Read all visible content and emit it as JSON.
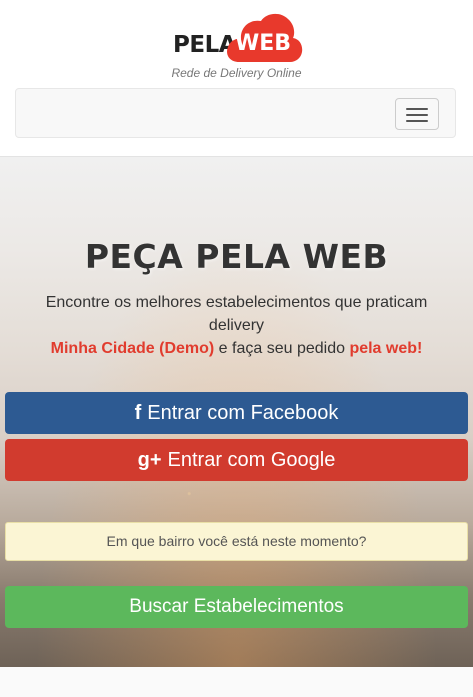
{
  "brand": {
    "logo_left": "PELA",
    "logo_right": "WEB",
    "tagline": "Rede de Delivery Online",
    "cloud_color": "#e8392c"
  },
  "navbar": {
    "toggle_icon": "hamburger-menu-icon"
  },
  "hero": {
    "title": "PEÇA PELA WEB",
    "line1": "Encontre os melhores estabelecimentos que praticam delivery",
    "city": "Minha Cidade (Demo)",
    "middle": " e faça seu pedido ",
    "web": "pela web!"
  },
  "buttons": {
    "facebook": {
      "icon": "f",
      "label": "Entrar com Facebook",
      "color": "#2d5a92"
    },
    "google": {
      "icon": "g+",
      "label": "Entrar com Google",
      "color": "#d13b2e"
    },
    "search": {
      "label": "Buscar Estabelecimentos",
      "color": "#5cb85c"
    }
  },
  "bairro_prompt": "Em que bairro você está neste momento?"
}
